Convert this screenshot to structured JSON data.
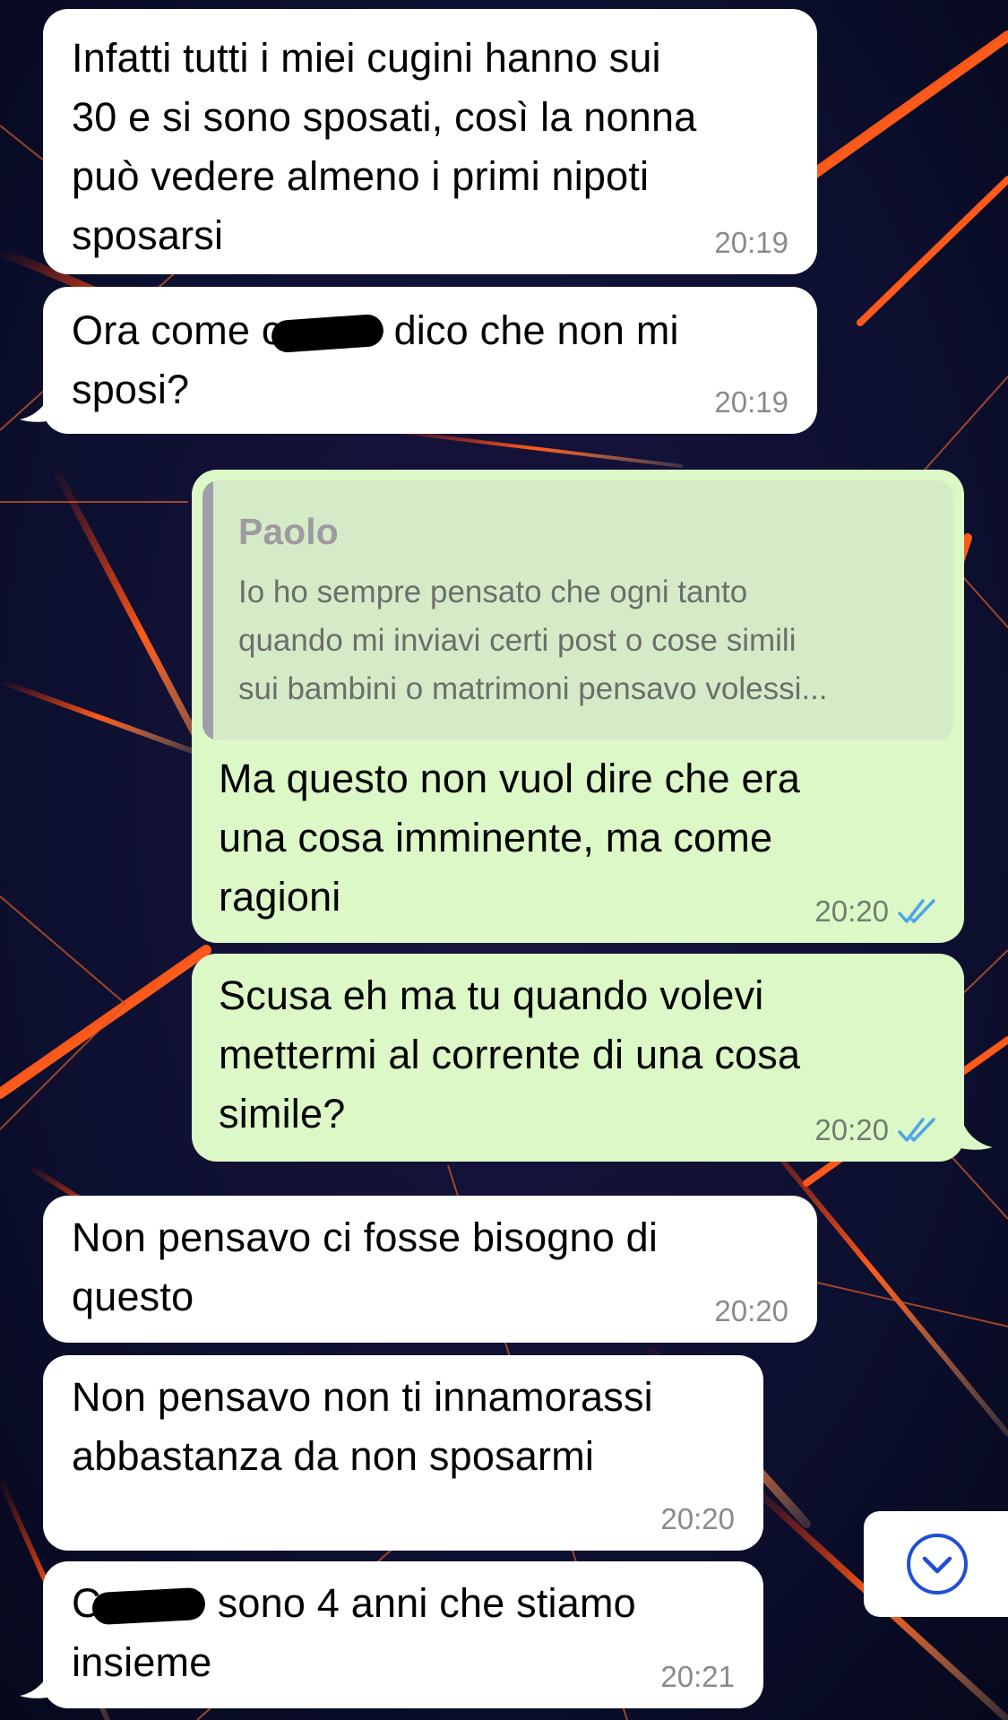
{
  "colors": {
    "incoming_bubble": "#ffffff",
    "outgoing_bubble": "#dcf8c6",
    "timestamp": "#8a8a8a",
    "read_ticks": "#4fa3e8",
    "scroll_button_icon": "#1f4ed8",
    "wallpaper_base": "#0b0f2a",
    "wallpaper_accent": "#ff4a1c"
  },
  "messages": [
    {
      "direction": "incoming",
      "text": "Infatti tutti i miei cugini hanno sui\n30 e si sono sposati, così la nonna\npuò vedere almeno i primi nipoti\nsposarsi",
      "time": "20:19"
    },
    {
      "direction": "incoming",
      "text_before_redaction": "Ora come c",
      "text_after_redaction": "dico che non mi\nsposi?",
      "time": "20:19",
      "redacted": true
    },
    {
      "direction": "outgoing",
      "reply_to": {
        "author": "Paolo",
        "text": "Io ho sempre pensato che ogni tanto\nquando mi inviavi certi post o cose simili\nsui bambini o matrimoni pensavo volessi..."
      },
      "text": "Ma questo non vuol dire che era\nuna cosa imminente, ma come\nragioni",
      "time": "20:20",
      "status": "read"
    },
    {
      "direction": "outgoing",
      "text": "Scusa eh ma tu quando volevi\nmettermi al corrente di una cosa\nsimile?",
      "time": "20:20",
      "status": "read"
    },
    {
      "direction": "incoming",
      "text": "Non pensavo ci fosse bisogno di\nquesto",
      "time": "20:20"
    },
    {
      "direction": "incoming",
      "text": "Non pensavo non ti innamorassi\nabbastanza da non sposarmi",
      "time": "20:20"
    },
    {
      "direction": "incoming",
      "text_before_redaction": "C",
      "text_after_redaction": "sono 4 anni che stiamo\ninsieme",
      "time": "20:21",
      "redacted": true
    }
  ],
  "scroll_button": {
    "icon": "chevron-down-circle-icon"
  }
}
